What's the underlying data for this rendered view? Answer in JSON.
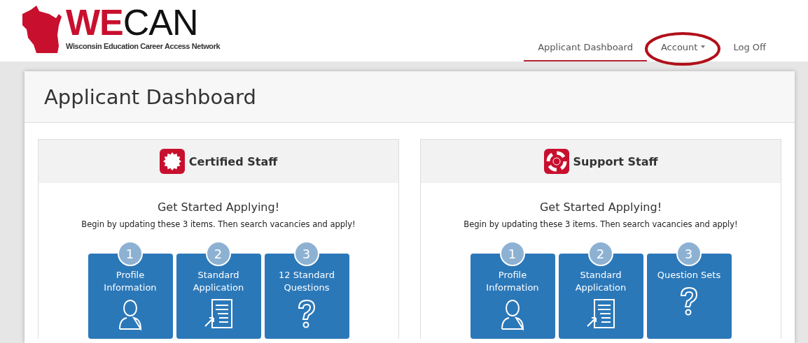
{
  "logo": {
    "accent": "WE",
    "rest": "CAN",
    "tagline": "Wisconsin Education Career Access Network"
  },
  "nav": [
    {
      "label": "Applicant Dashboard",
      "selected": true,
      "has_menu": false,
      "circled": false
    },
    {
      "label": "Account",
      "selected": false,
      "has_menu": true,
      "circled": true
    },
    {
      "label": "Log Off",
      "selected": false,
      "has_menu": false,
      "circled": false
    }
  ],
  "page_title": "Applicant Dashboard",
  "cards": [
    {
      "title": "Certified Staff",
      "kind": "badge",
      "heading": "Get Started Applying!",
      "intro": "Begin by updating these 3 items. Then search vacancies and apply!",
      "steps": [
        {
          "number": "1",
          "label": "Profile Information",
          "kind": "person"
        },
        {
          "number": "2",
          "label": "Standard Application",
          "kind": "document"
        },
        {
          "number": "3",
          "label": "12 Standard Questions",
          "kind": "question"
        }
      ]
    },
    {
      "title": "Support Staff",
      "kind": "lifebuoy",
      "heading": "Get Started Applying!",
      "intro": "Begin by updating these 3 items. Then search vacancies and apply!",
      "steps": [
        {
          "number": "1",
          "label": "Profile Information",
          "kind": "person"
        },
        {
          "number": "2",
          "label": "Standard Application",
          "kind": "document"
        },
        {
          "number": "3",
          "label": "Question Sets",
          "kind": "question"
        }
      ]
    }
  ]
}
